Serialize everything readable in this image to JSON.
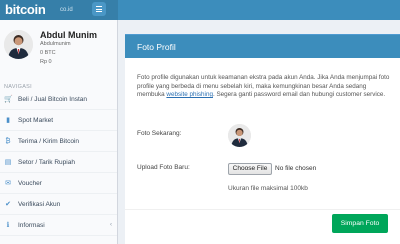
{
  "brand": {
    "name": "bitcoin",
    "suffix": "co.id"
  },
  "user": {
    "name": "Abdul Munim",
    "username": "Abdulmunim",
    "btc_balance": "0 BTC",
    "idr_balance": "Rp 0"
  },
  "sidebar": {
    "nav_header": "NAVIGASI",
    "items": [
      {
        "label": "Beli / Jual Bitcoin Instan",
        "icon": "cart-icon",
        "glyph": "🛒"
      },
      {
        "label": "Spot Market",
        "icon": "chart-icon",
        "glyph": "▮"
      },
      {
        "label": "Terima / Kirim Bitcoin",
        "icon": "bitcoin-icon",
        "glyph": "₿"
      },
      {
        "label": "Setor / Tarik Rupiah",
        "icon": "money-icon",
        "glyph": "▤"
      },
      {
        "label": "Voucher",
        "icon": "ticket-icon",
        "glyph": "✉"
      },
      {
        "label": "Verifikasi Akun",
        "icon": "check-circle-icon",
        "glyph": "✔"
      },
      {
        "label": "Informasi",
        "icon": "info-icon",
        "glyph": "ℹ",
        "chevron": "‹"
      }
    ]
  },
  "card": {
    "title": "Foto Profil",
    "description_before_link": "Foto profile digunakan untuk keamanan ekstra pada akun Anda. Jika Anda menjumpai foto profile yang berbeda di menu sebelah kiri, maka kemungkinan besar Anda sedang membuka ",
    "description_link": "website phishing",
    "description_after_link": ". Segera ganti password email dan hubungi customer service.",
    "current_photo_label": "Foto Sekarang:",
    "upload_label": "Upload Foto Baru:",
    "choose_file_label": "Choose File",
    "file_status": "No file chosen",
    "size_note": "Ukuran file maksimal 100kb",
    "save_label": "Simpan Foto"
  },
  "colors": {
    "header_blue": "#3c8dbc",
    "logo_blue": "#367fa9",
    "save_green": "#00a65a",
    "icon_blue": "#4a8fc9"
  }
}
